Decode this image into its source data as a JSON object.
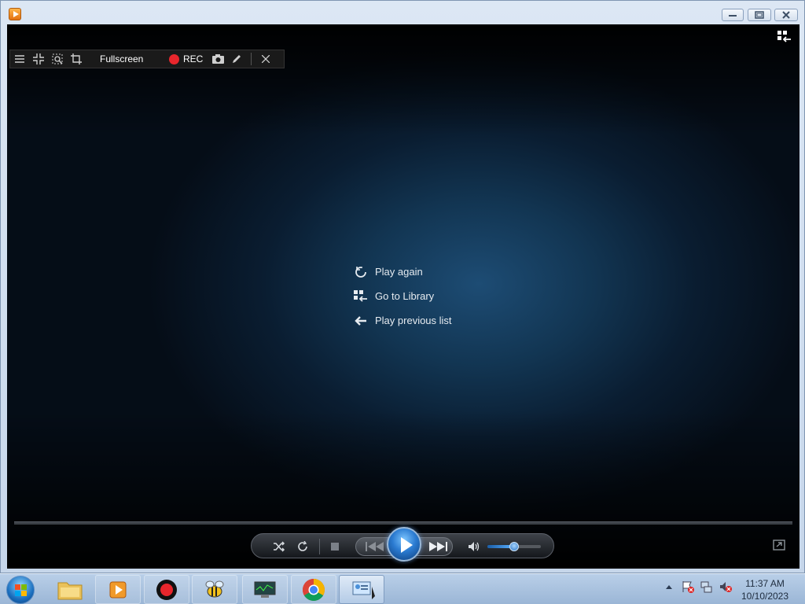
{
  "window": {
    "title": "",
    "controls": {
      "minimize": "minimize",
      "restore": "restore",
      "close": "close"
    }
  },
  "capture_toolbar": {
    "fullscreen_label": "Fullscreen",
    "rec_label": "REC",
    "icons": [
      "menu-icon",
      "shrink-icon",
      "region-zoom-icon",
      "crop-icon",
      "camera-icon",
      "pencil-icon",
      "close-icon"
    ]
  },
  "center_menu": {
    "items": [
      {
        "label": "Play again",
        "icon": "replay-icon"
      },
      {
        "label": "Go to Library",
        "icon": "library-icon"
      },
      {
        "label": "Play previous list",
        "icon": "back-arrow-icon"
      }
    ]
  },
  "playback": {
    "volume_level": 0.5,
    "buttons": [
      "shuffle-icon",
      "repeat-icon",
      "stop-icon",
      "previous-icon",
      "play-icon",
      "next-icon",
      "volume-icon"
    ]
  },
  "taskbar": {
    "apps": [
      "file-explorer",
      "media-player",
      "recorder",
      "bee-app",
      "system-monitor",
      "chrome",
      "control-panel"
    ],
    "clock": {
      "time": "11:37 AM",
      "date": "10/10/2023"
    }
  },
  "colors": {
    "accent": "#2b7bd1",
    "rec": "#e8262c",
    "video_bg": "#123552"
  }
}
